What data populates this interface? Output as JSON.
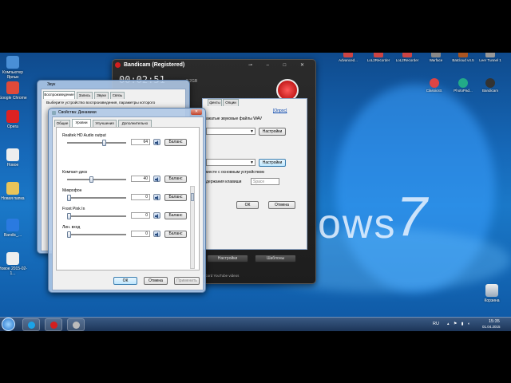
{
  "desktop": {
    "left_icons": [
      {
        "label": "Компьютер Ярлык",
        "color": "#4a8fd6"
      },
      {
        "label": "Google Chrome",
        "color": "#e04a3a"
      },
      {
        "label": "Opera",
        "color": "#d22"
      },
      {
        "label": "Новое",
        "color": "#eee"
      },
      {
        "label": "Новая папка",
        "color": "#e8c45a"
      },
      {
        "label": "Bandic_...",
        "color": "#2a7ae0"
      },
      {
        "label": "Новое 2015-02-1...",
        "color": "#eee"
      }
    ],
    "top_icons_row1": [
      {
        "label": "Advanced...",
        "color": "#c44"
      },
      {
        "label": "LoL2Recorder",
        "color": "#c44"
      },
      {
        "label": "LoL2Recorder",
        "color": "#c44"
      },
      {
        "label": "Warface",
        "color": "#888"
      },
      {
        "label": "Batcloud v4.5",
        "color": "#a52"
      },
      {
        "label": "Leer Tunnel 1",
        "color": "#999"
      }
    ],
    "top_icons_row2": [
      {
        "label": "Classicstr.",
        "color": "#d44"
      },
      {
        "label": "PhotoPad...",
        "color": "#2a8"
      },
      {
        "label": "Bandicam",
        "color": "#333"
      }
    ],
    "recycle_bin": "Корзина",
    "watermark_left": "ows",
    "watermark_seven": "7"
  },
  "taskbar": {
    "lang": "RU",
    "time": "15:35",
    "date": "01.04.2015"
  },
  "bandicam": {
    "title": "Bandicam (Registered)",
    "timer": "00:02:51",
    "size": "2.2GB",
    "link": "[Опрос]",
    "wav_text": "ажатые звуковые файлы WAV",
    "settings1": "Настройки",
    "settings2": "Настройки",
    "mix_text": "месте с основным устройством",
    "hotkey_text": "держания клавиши",
    "hotkey_value": "Space",
    "tabs": [
      "фекты",
      "Опции"
    ],
    "ok": "ОК",
    "cancel": "Отмена",
    "bottom_settings": "Настройки",
    "bottom_templates": "Шаблоны",
    "youtube": "ecord YouTube videos"
  },
  "sound_dialog": {
    "title": "Звук",
    "tabs": [
      "Воспроизведение",
      "Запись",
      "Звуки",
      "Связь"
    ],
    "desc": "Выберите устройство воспроизведения, параметры которого"
  },
  "speakers": {
    "title": "Свойства: Динамики",
    "tabs": [
      "Общие",
      "Уровни",
      "Улучшения",
      "Дополнительно"
    ],
    "balance": "Баланс",
    "rows": [
      {
        "name": "Realtek HD Audio output",
        "value": "64",
        "level": 0.64
      },
      {
        "name": "Компакт-диск",
        "value": "40",
        "level": 0.4
      },
      {
        "name": "Микрофон",
        "value": "0",
        "level": 0.0
      },
      {
        "name": "Front Pink In",
        "value": "0",
        "level": 0.0
      },
      {
        "name": "Лин. вход",
        "value": "0",
        "level": 0.0
      }
    ],
    "ok": "ОК",
    "cancel": "Отмена",
    "apply": "Применить"
  },
  "colors": {
    "accent_red": "#d21f1f",
    "desktop_blue": "#1668b8"
  }
}
